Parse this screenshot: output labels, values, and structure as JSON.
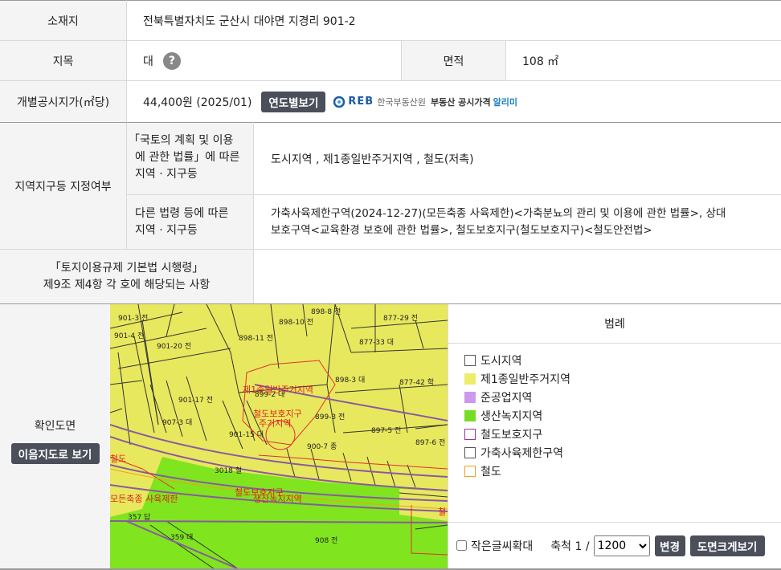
{
  "location": {
    "label": "소재지",
    "value": "전북특별자치도 군산시 대야면 지경리 901-2"
  },
  "land_category": {
    "label": "지목",
    "value": "대",
    "help_symbol": "?"
  },
  "area": {
    "label": "면적",
    "value": "108 ㎡"
  },
  "official_price": {
    "label": "개별공시지가(㎡당)",
    "value": "44,400원 (2025/01)",
    "year_button": "연도별보기",
    "reb_logo": "REB",
    "reb_name": "한국부동산원",
    "alert_prefix": "부동산 공시가격",
    "alert_suffix": "알리미"
  },
  "zoning": {
    "label": "지역지구등 지정여부",
    "row1": {
      "label_lines": [
        "「국토의 계획 및 이용",
        "에 관한 법률」에 따른",
        "지역 · 지구등"
      ],
      "value": "도시지역 , 제1종일반주거지역 , 철도(저촉)"
    },
    "row2": {
      "label_lines": [
        "다른 법령 등에 따른",
        "지역 · 지구등"
      ],
      "value_lines": [
        "가축사육제한구역(2024-12-27)(모든축종 사육제한)<가축분뇨의 관리 및 이용에 관한 법률>, 상대",
        "보호구역<교육환경 보호에 관한 법률>, 철도보호지구(철도보호지구)<철도안전법>"
      ]
    }
  },
  "enforcement": {
    "label_lines": [
      "「토지이용규제 기본법 시행령」",
      "제9조 제4항 각 호에 해당되는 사항"
    ],
    "value": ""
  },
  "map_section": {
    "label": "확인도면",
    "view_button": "이음지도로 보기",
    "map_labels": [
      "901-3 전",
      "901-4 전",
      "901-20 전",
      "898-11 전",
      "877-29 전",
      "877-33 대",
      "898-3 대",
      "877-42 학",
      "901-17 전",
      "899-2 대",
      "899-3 전",
      "897-5 전",
      "897-6 전",
      "907-3 대",
      "901-15 대",
      "900-7 종",
      "3018 철",
      "357 답",
      "359 대",
      "908 전",
      "898-8 전",
      "898-10 전",
      "제1종일반주거지역",
      "철도보호지구",
      "주거지역",
      "철도",
      "철도보호지구",
      "생산녹지지역",
      "모든축종 사육제한",
      "철"
    ]
  },
  "legend": {
    "title": "범례",
    "items": [
      {
        "label": "도시지역",
        "color": "#ffffff",
        "border": "#555555"
      },
      {
        "label": "제1종일반주거지역",
        "color": "#eded6a",
        "border": "#eded6a"
      },
      {
        "label": "준공업지역",
        "color": "#cc99ee",
        "border": "#cc99ee"
      },
      {
        "label": "생산녹지지역",
        "color": "#77dd22",
        "border": "#77dd22"
      },
      {
        "label": "철도보호지구",
        "color": "#ffffff",
        "border": "#993399"
      },
      {
        "label": "가축사육제한구역",
        "color": "#ffffff",
        "border": "#555555"
      },
      {
        "label": "철도",
        "color": "#ffffff",
        "border": "#f0a020"
      }
    ]
  },
  "controls": {
    "small_text_label": "작은글씨확대",
    "small_text_checked": false,
    "scale_label": "축척 1 /",
    "scale_value": "1200",
    "change_button": "변경",
    "enlarge_button": "도면크게보기"
  }
}
